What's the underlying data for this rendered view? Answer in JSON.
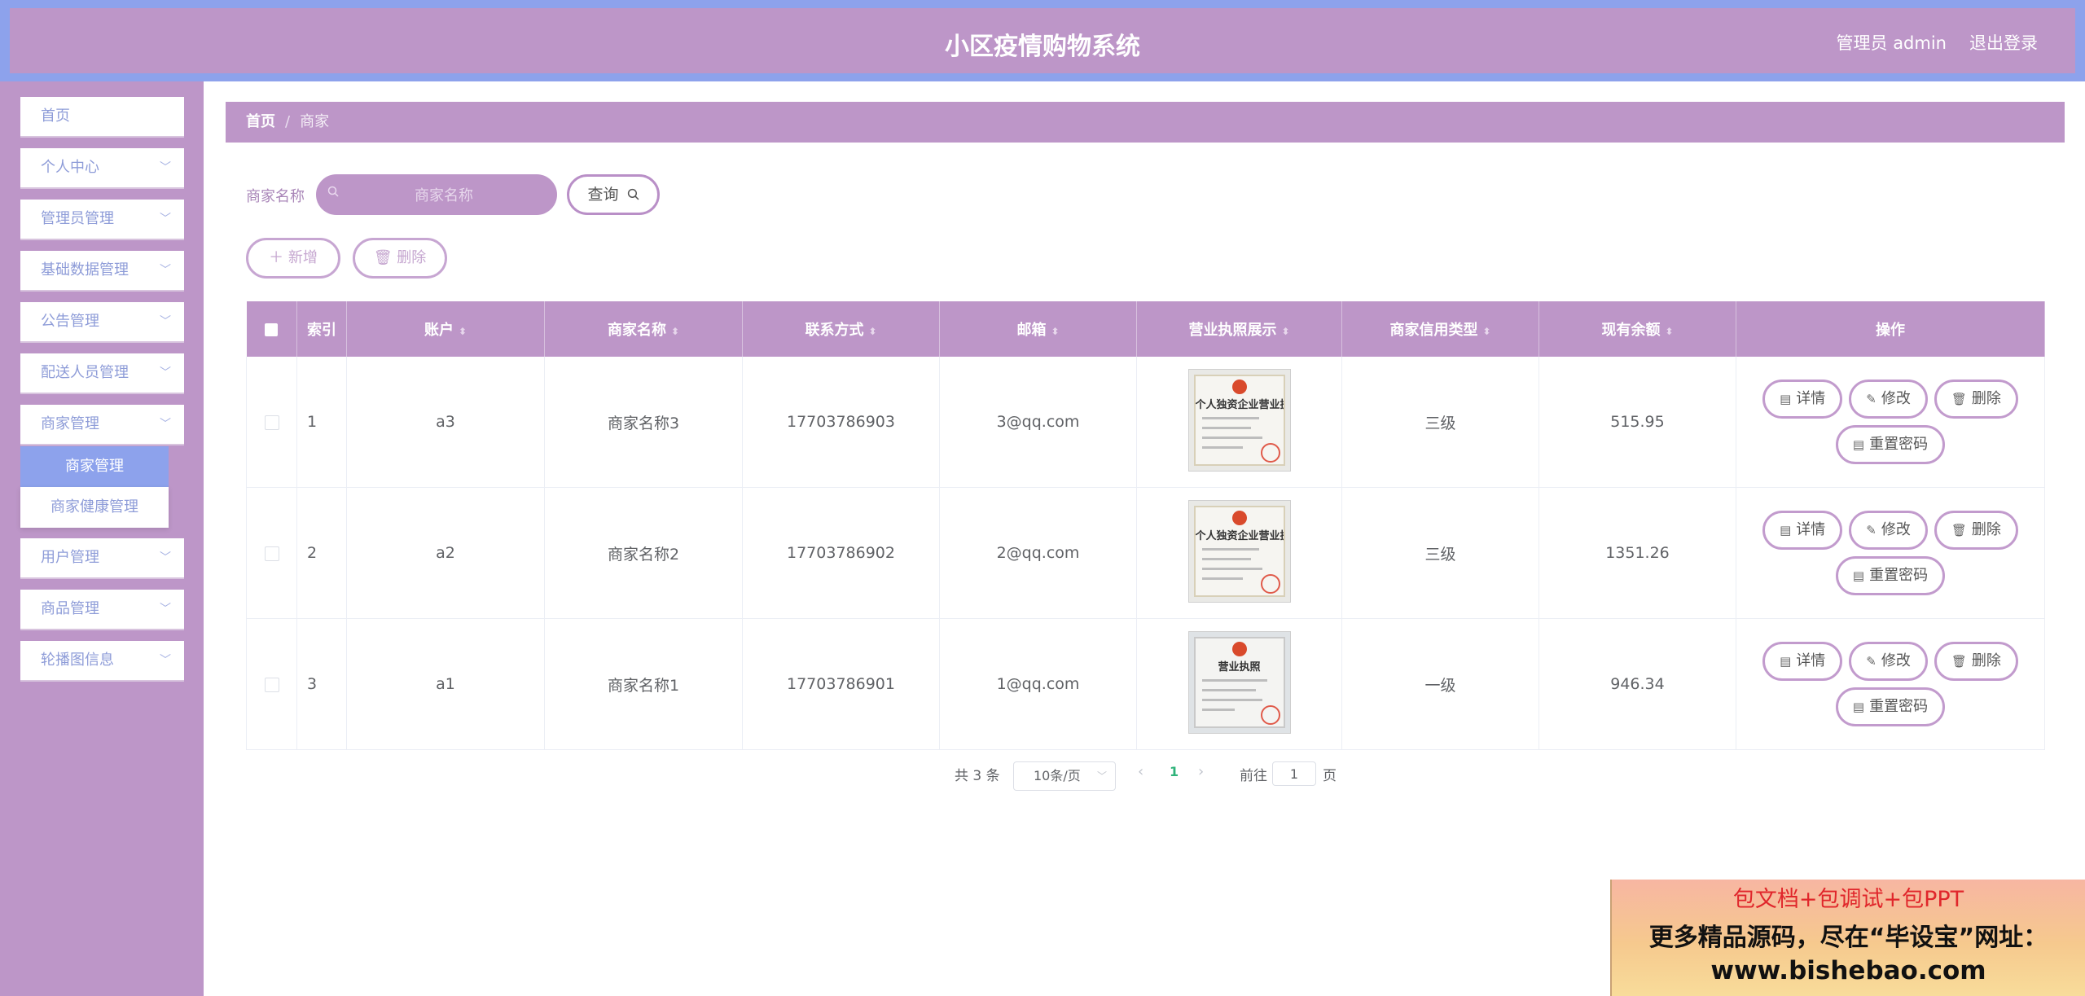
{
  "header": {
    "title": "小区疫情购物系统",
    "user": "管理员 admin",
    "logout": "退出登录"
  },
  "sidebar": {
    "items": [
      {
        "label": "首页",
        "has_children": false
      },
      {
        "label": "个人中心",
        "has_children": true
      },
      {
        "label": "管理员管理",
        "has_children": true
      },
      {
        "label": "基础数据管理",
        "has_children": true
      },
      {
        "label": "公告管理",
        "has_children": true
      },
      {
        "label": "配送人员管理",
        "has_children": true
      },
      {
        "label": "商家管理",
        "has_children": true,
        "expanded": true
      },
      {
        "label": "用户管理",
        "has_children": true
      },
      {
        "label": "商品管理",
        "has_children": true
      },
      {
        "label": "轮播图信息",
        "has_children": true
      }
    ],
    "submenu": [
      {
        "label": "商家管理",
        "active": true
      },
      {
        "label": "商家健康管理",
        "active": false
      }
    ]
  },
  "breadcrumb": {
    "home": "首页",
    "separator": "/",
    "current": "商家"
  },
  "search": {
    "label": "商家名称",
    "placeholder": "商家名称",
    "value": "",
    "query_label": "查询"
  },
  "actions": {
    "add_label": "新增",
    "delete_label": "删除"
  },
  "table": {
    "columns": [
      "索引",
      "账户",
      "商家名称",
      "联系方式",
      "邮箱",
      "营业执照展示",
      "商家信用类型",
      "现有余额",
      "操作"
    ],
    "sortable": [
      false,
      true,
      true,
      true,
      true,
      true,
      true,
      true,
      false
    ],
    "rows": [
      {
        "index": "1",
        "account": "a3",
        "name": "商家名称3",
        "phone": "17703786903",
        "email": "3@qq.com",
        "license_title": "个人独资企业营业执照",
        "credit": "三级",
        "balance": "515.95"
      },
      {
        "index": "2",
        "account": "a2",
        "name": "商家名称2",
        "phone": "17703786902",
        "email": "2@qq.com",
        "license_title": "个人独资企业营业执照",
        "credit": "三级",
        "balance": "1351.26"
      },
      {
        "index": "3",
        "account": "a1",
        "name": "商家名称1",
        "phone": "17703786901",
        "email": "1@qq.com",
        "license_title": "营业执照",
        "credit": "一级",
        "balance": "946.34"
      }
    ],
    "row_actions": {
      "detail": "详情",
      "edit": "修改",
      "delete": "删除",
      "reset": "重置密码"
    }
  },
  "pagination": {
    "total": "共 3 条",
    "page_size": "10条/页",
    "current_page": "1",
    "goto_label": "前往",
    "goto_value": "1",
    "page_suffix": "页"
  },
  "ad": {
    "line1": "包文档+包调试+包PPT",
    "line2": "更多精品源码，尽在“毕设宝”网址：",
    "line3": "www.bishebao.com"
  },
  "colors": {
    "header_frame": "#8da2ec",
    "primary_purple": "#bd96c8",
    "menu_text": "#8e9cd8",
    "active_submenu": "#8da2ec",
    "page_active": "#2fb37a"
  }
}
